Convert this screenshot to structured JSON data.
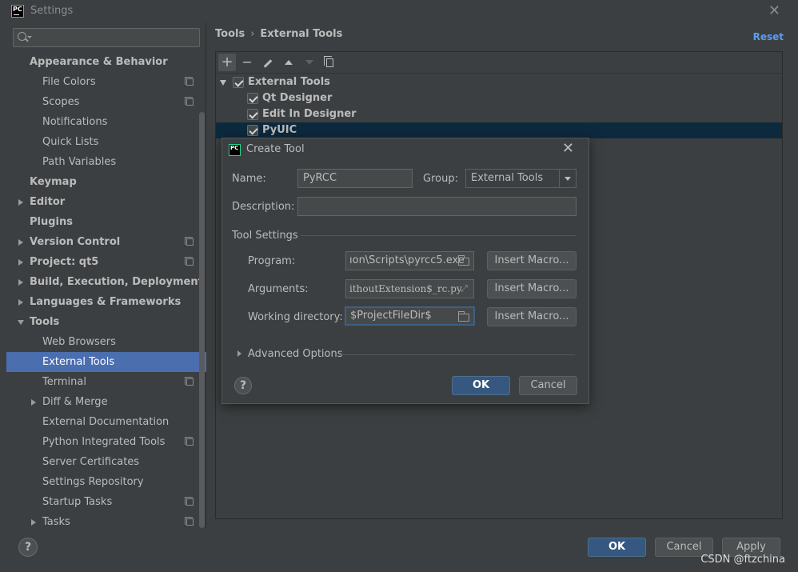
{
  "window": {
    "title": "Settings",
    "close_glyph": "✕"
  },
  "sidebar": {
    "search_placeholder": "",
    "items": [
      {
        "label": "Appearance & Behavior",
        "bold": true,
        "indent": 0
      },
      {
        "label": "File Colors",
        "indent": 1,
        "copy": true
      },
      {
        "label": "Scopes",
        "indent": 1,
        "copy": true
      },
      {
        "label": "Notifications",
        "indent": 1
      },
      {
        "label": "Quick Lists",
        "indent": 1
      },
      {
        "label": "Path Variables",
        "indent": 1
      },
      {
        "label": "Keymap",
        "bold": true,
        "indent": 0
      },
      {
        "label": "Editor",
        "bold": true,
        "indent": 0,
        "arrow": "right"
      },
      {
        "label": "Plugins",
        "bold": true,
        "indent": 0
      },
      {
        "label": "Version Control",
        "bold": true,
        "indent": 0,
        "arrow": "right",
        "copy": true
      },
      {
        "label": "Project: qt5",
        "bold": true,
        "indent": 0,
        "arrow": "right",
        "copy": true
      },
      {
        "label": "Build, Execution, Deployment",
        "bold": true,
        "indent": 0,
        "arrow": "right"
      },
      {
        "label": "Languages & Frameworks",
        "bold": true,
        "indent": 0,
        "arrow": "right"
      },
      {
        "label": "Tools",
        "bold": true,
        "indent": 0,
        "arrow": "down"
      },
      {
        "label": "Web Browsers",
        "indent": 1
      },
      {
        "label": "External Tools",
        "indent": 1,
        "selected": true
      },
      {
        "label": "Terminal",
        "indent": 1,
        "copy": true
      },
      {
        "label": "Diff & Merge",
        "indent": 1,
        "arrow": "right"
      },
      {
        "label": "External Documentation",
        "indent": 1
      },
      {
        "label": "Python Integrated Tools",
        "indent": 1,
        "copy": true
      },
      {
        "label": "Server Certificates",
        "indent": 1
      },
      {
        "label": "Settings Repository",
        "indent": 1
      },
      {
        "label": "Startup Tasks",
        "indent": 1,
        "copy": true
      },
      {
        "label": "Tasks",
        "indent": 1,
        "arrow": "right",
        "copy": true
      }
    ]
  },
  "header": {
    "breadcrumb_root": "Tools",
    "breadcrumb_sep": "›",
    "breadcrumb_leaf": "External Tools",
    "reset_label": "Reset"
  },
  "toolbar": {
    "add_glyph": "+",
    "remove_glyph": "−"
  },
  "external_tools": {
    "group_label": "External Tools",
    "tools": [
      {
        "label": "Qt Designer"
      },
      {
        "label": "Edit In Designer"
      },
      {
        "label": "PyUIC",
        "selected": true
      }
    ]
  },
  "dialog": {
    "title": "Create Tool",
    "close_glyph": "✕",
    "name_label": "Name:",
    "name_value": "PyRCC",
    "group_label": "Group:",
    "group_value": "External Tools",
    "description_label": "Description:",
    "description_value": "",
    "tool_settings_label": "Tool Settings",
    "program_label": "Program:",
    "program_value": "ıon\\Scripts\\pyrcc5.exe",
    "arguments_label": "Arguments:",
    "arguments_value": "ithoutExtension$_rc.py",
    "workdir_label": "Working directory:",
    "workdir_value": "$ProjectFileDir$",
    "insert_macro_label": "Insert Macro...",
    "advanced_label": "Advanced Options",
    "help_glyph": "?",
    "ok_label": "OK",
    "cancel_label": "Cancel"
  },
  "footer": {
    "help_glyph": "?",
    "ok_label": "OK",
    "cancel_label": "Cancel",
    "apply_label": "Apply",
    "watermark": "CSDN @ftzchina"
  },
  "colors": {
    "background": "#3c3f41",
    "selection": "#4b6eaf",
    "tree_selection": "#0d293e",
    "primary_button": "#365880",
    "link": "#589df6",
    "logo_accent": "#21d789"
  }
}
